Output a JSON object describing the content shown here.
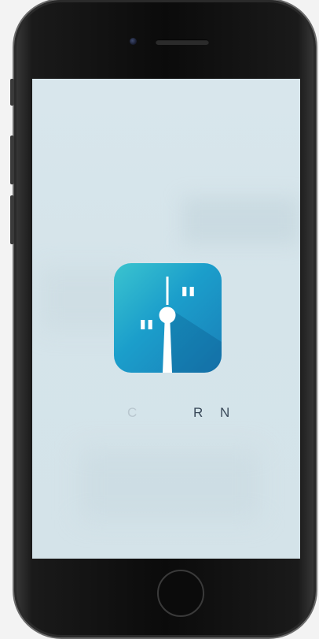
{
  "splash": {
    "brand_text_chars": [
      "C",
      "R",
      "N"
    ]
  },
  "colors": {
    "screen_bg": "#d6e5eb",
    "icon_gradient_start": "#3bc4cf",
    "icon_gradient_end": "#1a7fb8",
    "text": "#3a4a5a"
  },
  "icons": {
    "app_icon": "berlin-tv-tower-quote-icon",
    "home_button": "home-button-icon"
  }
}
